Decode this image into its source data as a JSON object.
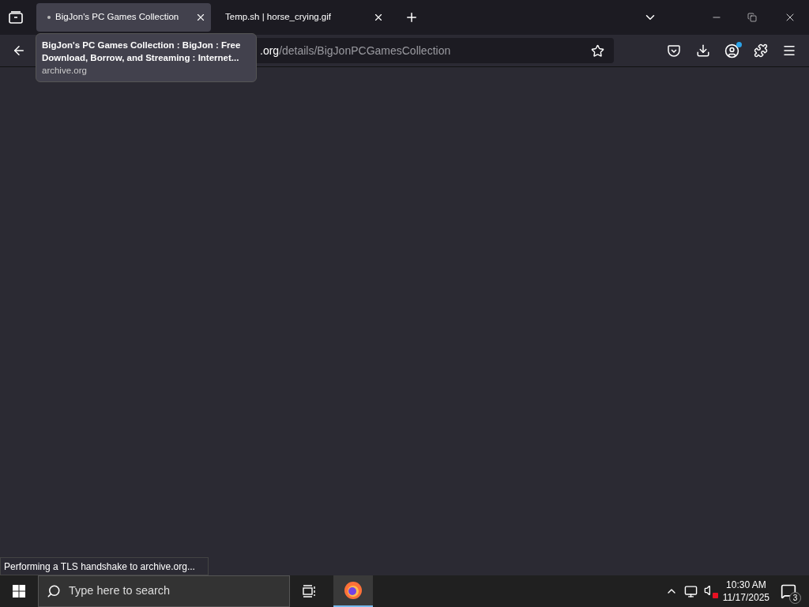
{
  "tabs": [
    {
      "title": "BigJon's PC Games Collection",
      "selected": true,
      "loading": true
    },
    {
      "title": "Temp.sh | horse_crying.gif",
      "selected": false,
      "loading": false
    }
  ],
  "tooltip": {
    "title": "BigJon's PC Games Collection : BigJon : Free Download, Borrow, and Streaming : Internet...",
    "domain": "archive.org"
  },
  "address": {
    "host": ".org",
    "path": "/details/BigJonPCGamesCollection"
  },
  "account": {
    "notification": true
  },
  "status": "Performing a TLS handshake to archive.org...",
  "taskbar": {
    "search_placeholder": "Type here to search",
    "firefox_active": true,
    "volume_muted": true,
    "time": "10:30 AM",
    "date": "11/17/2025",
    "notifications": "3"
  }
}
